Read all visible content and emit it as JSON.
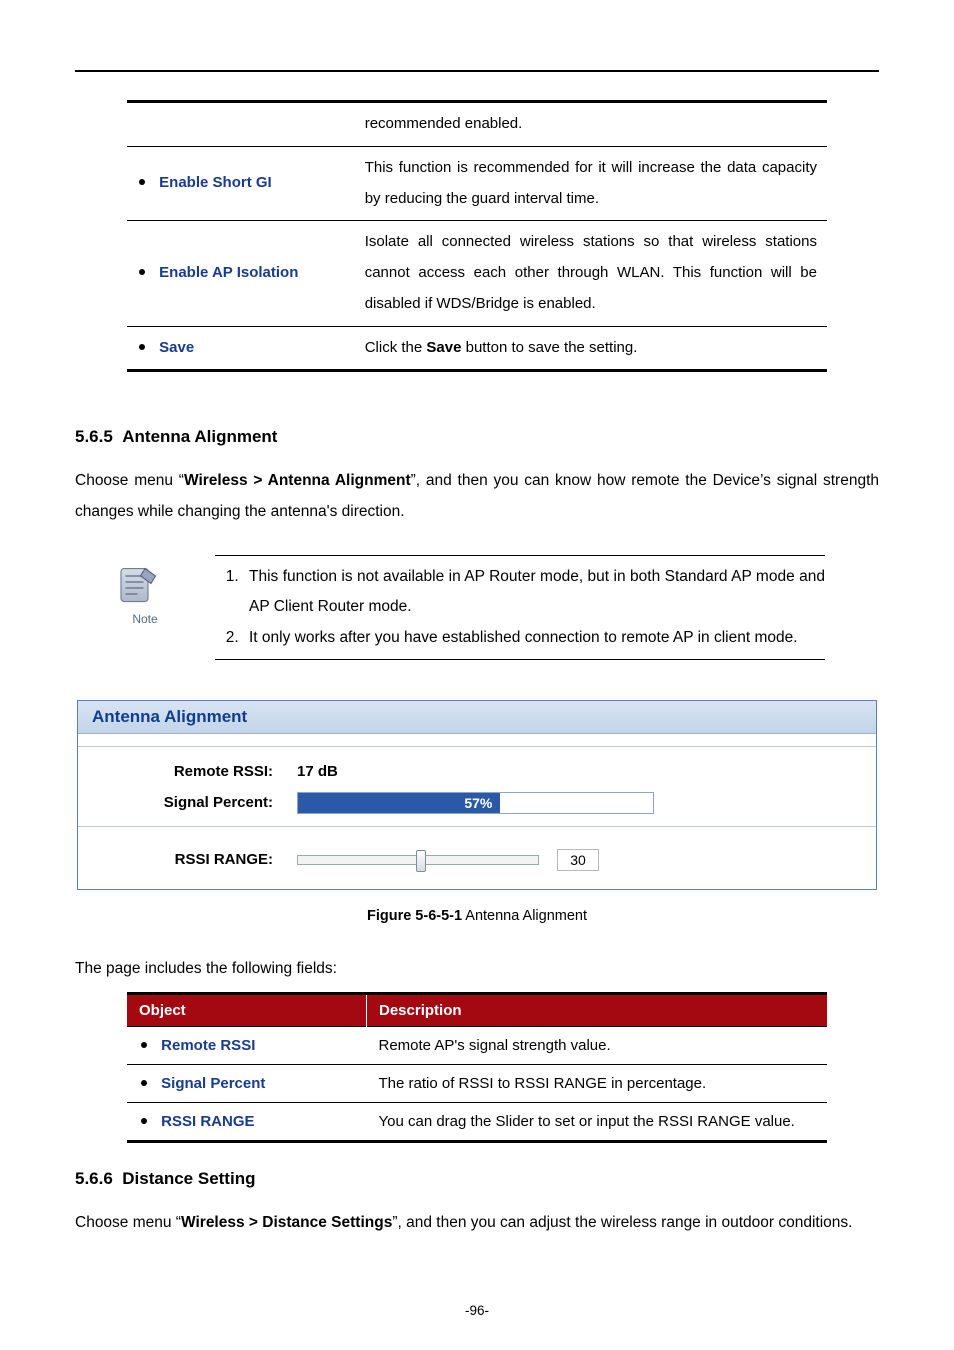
{
  "page_number": "-96-",
  "tbl1": {
    "rows": [
      {
        "label": "",
        "desc": "recommended enabled."
      },
      {
        "label": "Enable Short GI",
        "desc": "This function is recommended for it will increase the data capacity by reducing the guard interval time."
      },
      {
        "label": "Enable AP Isolation",
        "desc": "Isolate all connected wireless stations so that wireless stations cannot access each other through WLAN. This function will be disabled if WDS/Bridge is enabled."
      },
      {
        "label": "Save",
        "desc_pre": "Click the ",
        "desc_bold": "Save",
        "desc_post": " button to save the setting."
      }
    ]
  },
  "sec565": {
    "num": "5.6.5",
    "title": "Antenna Alignment",
    "para_pre": "Choose menu “",
    "para_bold": "Wireless > Antenna Alignment",
    "para_post": "”, and then you can know how remote the Device’s signal strength changes while changing the antenna's direction."
  },
  "note": {
    "label": "Note",
    "items": [
      "This function is not available in AP Router mode, but in both Standard AP mode and AP Client Router mode.",
      "It only works after you have established connection to remote AP in client mode."
    ]
  },
  "shot": {
    "title": "Antenna Alignment",
    "rows": {
      "remote_rssi_label": "Remote RSSI:",
      "remote_rssi_value": "17 dB",
      "signal_percent_label": "Signal Percent:",
      "signal_percent_value": "57%",
      "signal_percent_num": 57,
      "rssi_range_label": "RSSI RANGE:",
      "rssi_range_value": "30"
    }
  },
  "fig": {
    "bold": "Figure 5-6-5-1",
    "rest": " Antenna Alignment"
  },
  "lead2": "The page includes the following fields:",
  "tbl2": {
    "head": {
      "c1": "Object",
      "c2": "Description"
    },
    "rows": [
      {
        "label": "Remote RSSI",
        "desc": "Remote AP's signal strength value."
      },
      {
        "label": "Signal Percent",
        "desc": "The ratio of RSSI to RSSI RANGE in percentage."
      },
      {
        "label": "RSSI RANGE",
        "desc": "You can drag the Slider to set or input the RSSI RANGE value."
      }
    ]
  },
  "sec566": {
    "num": "5.6.6",
    "title": "Distance Setting",
    "para_pre": "Choose menu “",
    "para_bold": "Wireless > Distance Settings",
    "para_post": "”, and then you can adjust the wireless range in outdoor conditions."
  },
  "chart_data": {
    "type": "bar",
    "title": "Antenna Alignment",
    "categories": [
      "Signal Percent"
    ],
    "values": [
      57
    ],
    "ylim": [
      0,
      100
    ],
    "ylabel": "%",
    "annotations": {
      "Remote RSSI": "17 dB",
      "RSSI RANGE": 30
    }
  }
}
